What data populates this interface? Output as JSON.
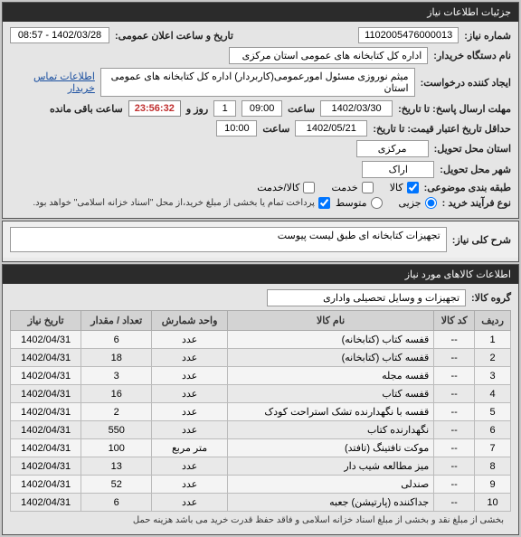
{
  "panel1_title": "جزئیات اطلاعات نیاز",
  "need_no_label": "شماره نیاز:",
  "need_no_value": "1102005476000013",
  "ann_dt_label": "تاریخ و ساعت اعلان عمومی:",
  "ann_dt_value": "1402/03/28 - 08:57",
  "buyer_label": "نام دستگاه خریدار:",
  "buyer_value": "اداره کل کتابخانه های عمومی استان مرکزی",
  "creator_label": "ایجاد کننده درخواست:",
  "creator_value": "میثم نوروزی مسئول امورعمومی(کاربردار) اداره کل کتابخانه های عمومی استان",
  "contact_link": "اطلاعات تماس خریدار",
  "deadline_label": "مهلت ارسال پاسخ: تا تاریخ:",
  "deadline_date": "1402/03/30",
  "time_label": "ساعت",
  "deadline_time": "09:00",
  "days_label": "روز و",
  "days_value": "1",
  "countdown": "23:56:32",
  "remain_text": "ساعت باقی مانده",
  "valid_label": "حداقل تاریخ اعتبار قیمت: تا تاریخ:",
  "valid_date": "1402/05/21",
  "valid_time": "10:00",
  "loc_label": "استان محل تحویل:",
  "loc_value": "مرکزی",
  "city_label": "شهر محل تحویل:",
  "city_value": "اراک",
  "class_label": "طبقه بندی موضوعی:",
  "opt_goods": "کالا",
  "opt_service": "خدمت",
  "opt_both": "کالا/خدمت",
  "proc_label": "نوع فرآیند خرید :",
  "opt_minor": "جزیی",
  "opt_medium": "متوسط",
  "pay_note": "پرداخت تمام یا بخشی از مبلغ خرید،از محل \"اسناد خزانه اسلامی\" خواهد بود.",
  "desc_label": "شرح کلی نیاز:",
  "desc_value": "تجهیزات کتابخانه ای طبق لیست پیوست",
  "panel2_title": "اطلاعات کالاهای مورد نیاز",
  "group_label": "گروه کالا:",
  "group_value": "تجهیزات و وسایل تحصیلی واداری",
  "h_row": "ردیف",
  "h_code": "کد کالا",
  "h_name": "نام کالا",
  "h_unit": "واحد شمارش",
  "h_qty": "تعداد / مقدار",
  "h_date": "تاریخ نیاز",
  "rows": [
    {
      "n": "1",
      "code": "--",
      "name": "قفسه کتاب (کتابخانه)",
      "unit": "عدد",
      "qty": "6",
      "date": "1402/04/31"
    },
    {
      "n": "2",
      "code": "--",
      "name": "قفسه کتاب (کتابخانه)",
      "unit": "عدد",
      "qty": "18",
      "date": "1402/04/31"
    },
    {
      "n": "3",
      "code": "--",
      "name": "قفسه مجله",
      "unit": "عدد",
      "qty": "3",
      "date": "1402/04/31"
    },
    {
      "n": "4",
      "code": "--",
      "name": "قفسه کتاب",
      "unit": "عدد",
      "qty": "16",
      "date": "1402/04/31"
    },
    {
      "n": "5",
      "code": "--",
      "name": "قفسه با نگهدارنده تشک استراحت کودک",
      "unit": "عدد",
      "qty": "2",
      "date": "1402/04/31"
    },
    {
      "n": "6",
      "code": "--",
      "name": "نگهدارنده کتاب",
      "unit": "عدد",
      "qty": "550",
      "date": "1402/04/31"
    },
    {
      "n": "7",
      "code": "--",
      "name": "موکت تافتینگ (تافتد)",
      "unit": "متر مربع",
      "qty": "100",
      "date": "1402/04/31"
    },
    {
      "n": "8",
      "code": "--",
      "name": "میز مطالعه شیب دار",
      "unit": "عدد",
      "qty": "13",
      "date": "1402/04/31"
    },
    {
      "n": "9",
      "code": "--",
      "name": "صندلی",
      "unit": "عدد",
      "qty": "52",
      "date": "1402/04/31"
    },
    {
      "n": "10",
      "code": "--",
      "name": "جداکننده (پارتیشن) جعبه",
      "unit": "عدد",
      "qty": "6",
      "date": "1402/04/31"
    }
  ],
  "footer": "بخشی از مبلغ نقد و بخشی از مبلغ اسناد خزانه اسلامی و فاقد حفظ قدرت خرید می باشد هزینه حمل"
}
